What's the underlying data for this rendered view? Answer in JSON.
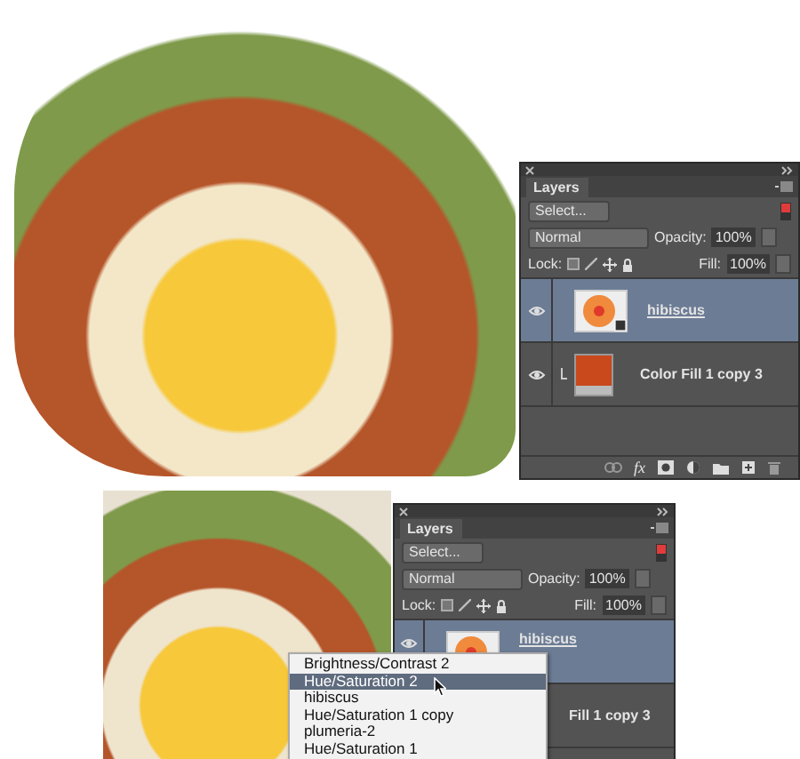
{
  "panels": [
    {
      "tab": "Layers",
      "filter": "Select...",
      "blend_mode": "Normal",
      "opacity_label": "Opacity:",
      "opacity": "100%",
      "lock_label": "Lock:",
      "fill_label": "Fill:",
      "fill": "100%",
      "layers": [
        {
          "name": "hibiscus",
          "kind": "image",
          "selected": true,
          "visible": true,
          "clipped": false
        },
        {
          "name": "Color Fill 1 copy 3",
          "kind": "fill",
          "selected": false,
          "visible": true,
          "clipped": true,
          "color": "#c9481c"
        }
      ],
      "footer": {
        "fx": "fx"
      }
    },
    {
      "tab": "Layers",
      "filter": "Select...",
      "blend_mode": "Normal",
      "opacity_label": "Opacity:",
      "opacity": "100%",
      "lock_label": "Lock:",
      "fill_label": "Fill:",
      "fill": "100%",
      "layers": [
        {
          "name": "hibiscus",
          "kind": "image",
          "selected": true,
          "visible": true,
          "clipped": false
        },
        {
          "name": "Fill 1 copy 3",
          "selected": false
        }
      ],
      "menu": [
        {
          "label": "Brightness/Contrast 2",
          "selected": false
        },
        {
          "label": "Hue/Saturation 2",
          "selected": true
        },
        {
          "label": "hibiscus",
          "selected": false
        },
        {
          "label": "Hue/Saturation 1 copy",
          "selected": false
        },
        {
          "label": "plumeria-2",
          "selected": false
        },
        {
          "label": "Hue/Saturation 1",
          "selected": false
        }
      ]
    }
  ]
}
